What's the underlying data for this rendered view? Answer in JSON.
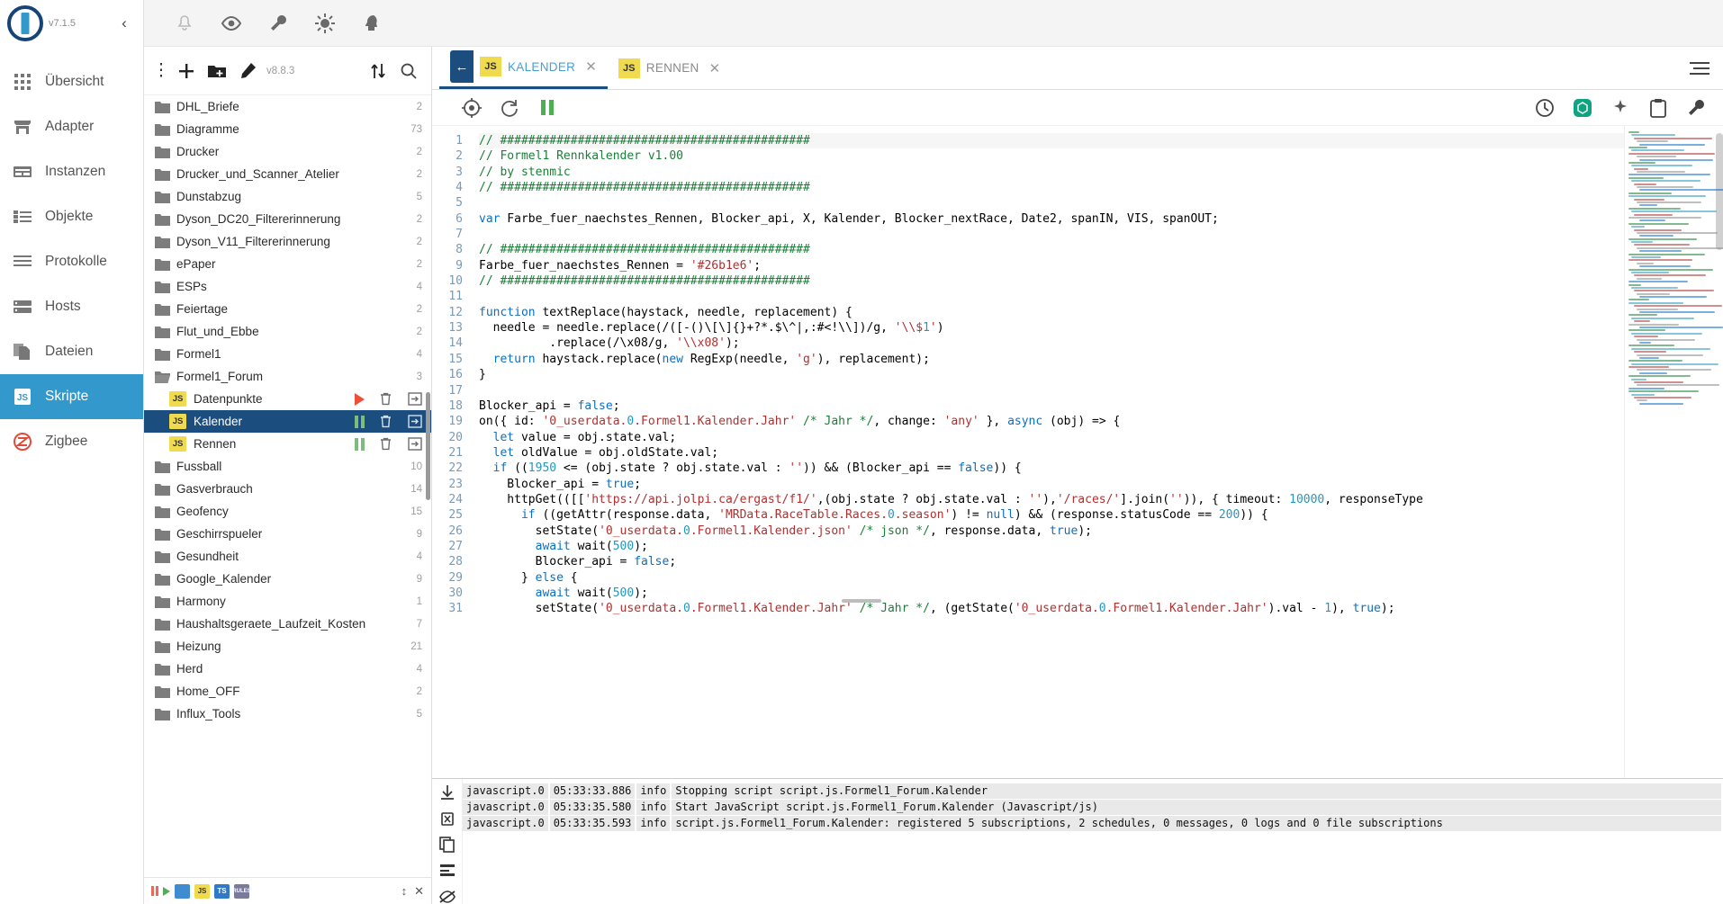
{
  "brand": {
    "version": "v7.1.5",
    "collapse_icon": "chevron-left-icon"
  },
  "sidebar": {
    "items": [
      {
        "label": "Übersicht",
        "icon": "grid-icon",
        "active": false
      },
      {
        "label": "Adapter",
        "icon": "store-icon",
        "active": false
      },
      {
        "label": "Instanzen",
        "icon": "instances-icon",
        "active": false
      },
      {
        "label": "Objekte",
        "icon": "list-icon",
        "active": false
      },
      {
        "label": "Protokolle",
        "icon": "lines-icon",
        "active": false
      },
      {
        "label": "Hosts",
        "icon": "server-icon",
        "active": false
      },
      {
        "label": "Dateien",
        "icon": "files-icon",
        "active": false
      },
      {
        "label": "Skripte",
        "icon": "js-icon",
        "active": true
      },
      {
        "label": "Zigbee",
        "icon": "zigbee-icon",
        "active": false
      }
    ]
  },
  "topbar": {
    "icons": [
      "bell-icon",
      "eye-icon",
      "wrench-icon",
      "brightness-icon",
      "head-idea-icon"
    ]
  },
  "tree": {
    "toolbar": {
      "menu_icon": "more-vertical-icon",
      "add_icon": "plus-icon",
      "new_folder_icon": "folder-plus-icon",
      "edit_icon": "pencil-icon",
      "version": "v8.8.3",
      "sort_icon": "sort-icon",
      "search_icon": "search-icon"
    },
    "rows": [
      {
        "name": "DHL_Briefe",
        "type": "folder",
        "count": "2"
      },
      {
        "name": "Diagramme",
        "type": "folder",
        "count": "73"
      },
      {
        "name": "Drucker",
        "type": "folder",
        "count": "2"
      },
      {
        "name": "Drucker_und_Scanner_Atelier",
        "type": "folder",
        "count": "2"
      },
      {
        "name": "Dunstabzug",
        "type": "folder",
        "count": "5"
      },
      {
        "name": "Dyson_DC20_Filtererinnerung",
        "type": "folder",
        "count": "2"
      },
      {
        "name": "Dyson_V11_Filtererinnerung",
        "type": "folder",
        "count": "2"
      },
      {
        "name": "ePaper",
        "type": "folder",
        "count": "2"
      },
      {
        "name": "ESPs",
        "type": "folder",
        "count": "4"
      },
      {
        "name": "Feiertage",
        "type": "folder",
        "count": "2"
      },
      {
        "name": "Flut_und_Ebbe",
        "type": "folder",
        "count": "2"
      },
      {
        "name": "Formel1",
        "type": "folder",
        "count": "4"
      },
      {
        "name": "Formel1_Forum",
        "type": "folder-open",
        "count": "3"
      },
      {
        "name": "Datenpunkte",
        "type": "script",
        "state": "running",
        "selected": false
      },
      {
        "name": "Kalender",
        "type": "script",
        "state": "paused",
        "selected": true
      },
      {
        "name": "Rennen",
        "type": "script",
        "state": "paused",
        "selected": false
      },
      {
        "name": "Fussball",
        "type": "folder",
        "count": "10"
      },
      {
        "name": "Gasverbrauch",
        "type": "folder",
        "count": "14"
      },
      {
        "name": "Geofency",
        "type": "folder",
        "count": "15"
      },
      {
        "name": "Geschirrspueler",
        "type": "folder",
        "count": "9"
      },
      {
        "name": "Gesundheit",
        "type": "folder",
        "count": "4"
      },
      {
        "name": "Google_Kalender",
        "type": "folder",
        "count": "9"
      },
      {
        "name": "Harmony",
        "type": "folder",
        "count": "1"
      },
      {
        "name": "Haushaltsgeraete_Laufzeit_Kosten",
        "type": "folder",
        "count": "7"
      },
      {
        "name": "Heizung",
        "type": "folder",
        "count": "21"
      },
      {
        "name": "Herd",
        "type": "folder",
        "count": "4"
      },
      {
        "name": "Home_OFF",
        "type": "folder",
        "count": "2"
      },
      {
        "name": "Influx_Tools",
        "type": "folder",
        "count": "5"
      }
    ],
    "row_actions": {
      "delete_icon": "trash-icon",
      "export_icon": "export-icon"
    },
    "footer": {
      "badges": [
        "JS",
        "TS",
        "RULES"
      ],
      "expand_icon": "chevron-updown-icon",
      "collapse_icon": "collapse-icon"
    }
  },
  "editor": {
    "tabs": [
      {
        "label": "KALENDER",
        "active": true,
        "back_icon": "arrow-left-icon",
        "close_icon": "close-icon"
      },
      {
        "label": "RENNEN",
        "active": false,
        "close_icon": "close-icon"
      }
    ],
    "tabbar_menu_icon": "hamburger-icon",
    "tools": {
      "locate_icon": "crosshair-icon",
      "reload_icon": "refresh-icon",
      "pause_icon": "pause-icon",
      "history_icon": "clock-icon",
      "chatgpt_icon": "chatgpt-icon",
      "sparkle_icon": "sparkle-icon",
      "clipboard_icon": "clipboard-icon",
      "settings_icon": "wrench-icon"
    },
    "first_line_number": 1,
    "lines": [
      "// ############################################",
      "// Formel1 Rennkalender v1.00",
      "// by stenmic",
      "// ############################################",
      "",
      "var Farbe_fuer_naechstes_Rennen, Blocker_api, X, Kalender, Blocker_nextRace, Date2, spanIN, VIS, spanOUT;",
      "",
      "// ############################################",
      "Farbe_fuer_naechstes_Rennen = '#26b1e6';",
      "// ############################################",
      "",
      "function textReplace(haystack, needle, replacement) {",
      "  needle = needle.replace(/([-()\\[\\]{}+?*.$\\^|,:#<!\\\\])/g, '\\\\$1')",
      "          .replace(/\\x08/g, '\\\\x08');",
      "  return haystack.replace(new RegExp(needle, 'g'), replacement);",
      "}",
      "",
      "Blocker_api = false;",
      "on({ id: '0_userdata.0.Formel1.Kalender.Jahr' /* Jahr */, change: 'any' }, async (obj) => {",
      "  let value = obj.state.val;",
      "  let oldValue = obj.oldState.val;",
      "  if ((1950 <= (obj.state ? obj.state.val : '')) && (Blocker_api == false)) {",
      "    Blocker_api = true;",
      "    httpGet(([['https://api.jolpi.ca/ergast/f1/',(obj.state ? obj.state.val : ''),'/races/'].join('')), { timeout: 10000, responseType",
      "      if ((getAttr(response.data, 'MRData.RaceTable.Races.0.season') != null) && (response.statusCode == 200)) {",
      "        setState('0_userdata.0.Formel1.Kalender.json' /* json */, response.data, true);",
      "        await wait(500);",
      "        Blocker_api = false;",
      "      } else {",
      "        await wait(500);",
      "        setState('0_userdata.0.Formel1.Kalender.Jahr' /* Jahr */, (getState('0_userdata.0.Formel1.Kalender.Jahr').val - 1), true);"
    ]
  },
  "console": {
    "tools": [
      "download-icon",
      "delete-log-icon",
      "copy-icon",
      "list-icon",
      "hide-icon"
    ],
    "rows": [
      {
        "source": "javascript.0",
        "time": "05:33:33.886",
        "level": "info",
        "message": "Stopping script script.js.Formel1_Forum.Kalender"
      },
      {
        "source": "javascript.0",
        "time": "05:33:35.580",
        "level": "info",
        "message": "Start JavaScript script.js.Formel1_Forum.Kalender (Javascript/js)"
      },
      {
        "source": "javascript.0",
        "time": "05:33:35.593",
        "level": "info",
        "message": "script.js.Formel1_Forum.Kalender: registered 5 subscriptions, 2 schedules, 0 messages, 0 logs and 0 file subscriptions"
      }
    ]
  },
  "colors": {
    "accent": "#3399cc",
    "selected_row": "#1b4d7e",
    "js_yellow": "#f0db4f",
    "running_green": "#4caf50",
    "stopped_red": "#ef4e3a"
  }
}
